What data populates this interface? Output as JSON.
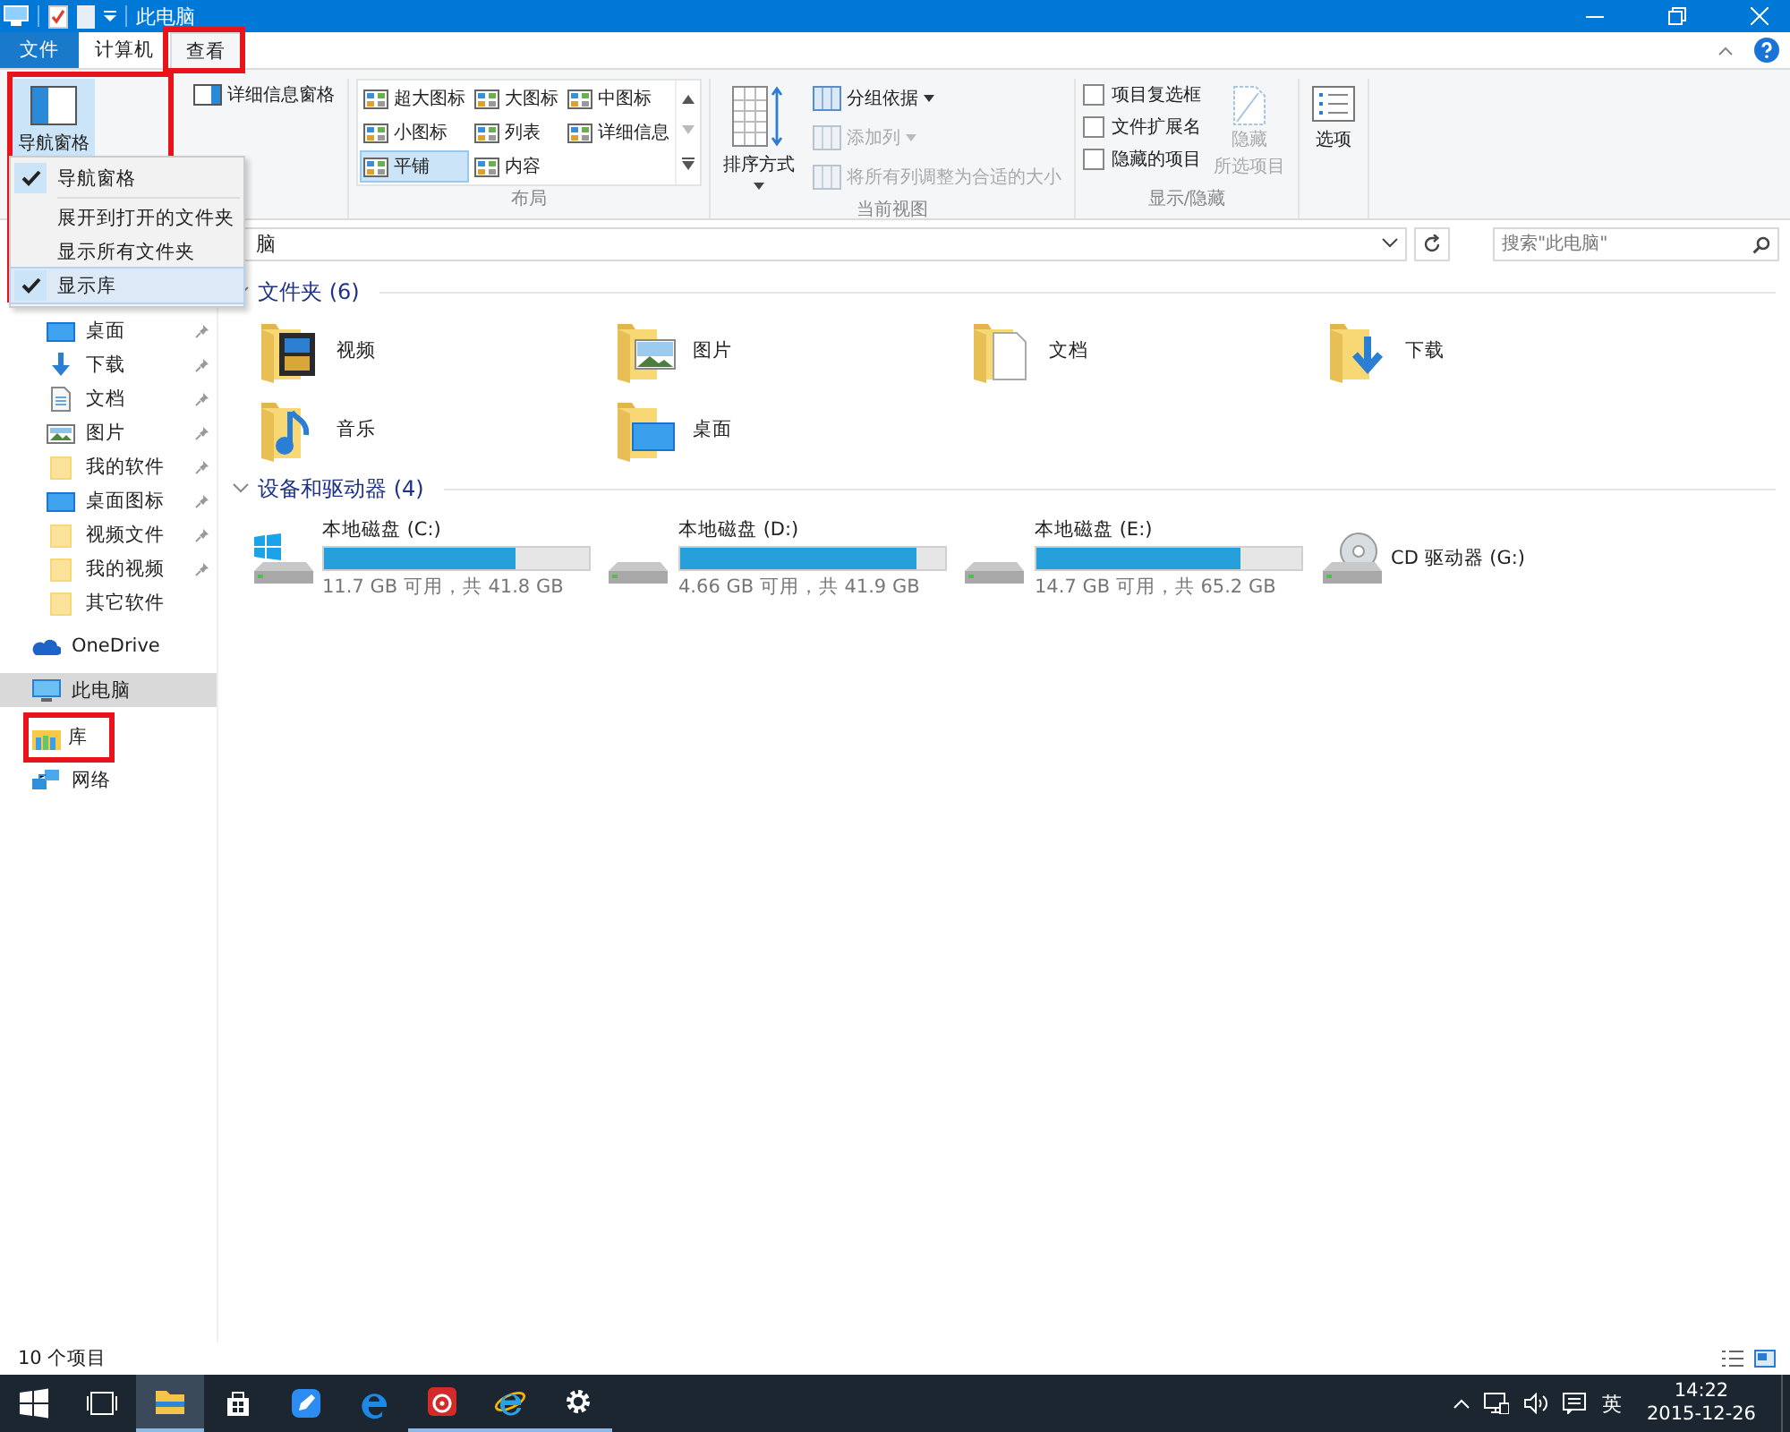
{
  "window": {
    "title": "此电脑"
  },
  "ribbon_tabs": [
    {
      "label": "文件",
      "kind": "file",
      "selected": false
    },
    {
      "label": "计算机",
      "kind": "tab",
      "selected": false
    },
    {
      "label": "查看",
      "kind": "tab",
      "selected": true
    }
  ],
  "ribbon": {
    "panes": {
      "navigation_pane": {
        "label": "导航窗格",
        "selected": true
      },
      "details_pane": {
        "label": "详细信息窗格"
      }
    },
    "layout": {
      "label": "布局",
      "options": [
        {
          "label": "超大图标",
          "selected": false
        },
        {
          "label": "大图标",
          "selected": false
        },
        {
          "label": "中图标",
          "selected": false
        },
        {
          "label": "小图标",
          "selected": false
        },
        {
          "label": "列表",
          "selected": false
        },
        {
          "label": "详细信息",
          "selected": false
        },
        {
          "label": "平铺",
          "selected": true
        },
        {
          "label": "内容",
          "selected": false
        }
      ]
    },
    "current_view": {
      "label": "当前视图",
      "sort": "排序方式",
      "commands": [
        {
          "label": "分组依据",
          "disabled": false,
          "dropdown": true
        },
        {
          "label": "添加列",
          "disabled": true,
          "dropdown": true
        },
        {
          "label": "将所有列调整为合适的大小",
          "disabled": true,
          "dropdown": false
        }
      ]
    },
    "show_hide": {
      "label": "显示/隐藏",
      "checkboxes": [
        {
          "label": "项目复选框",
          "checked": false
        },
        {
          "label": "文件扩展名",
          "checked": false
        },
        {
          "label": "隐藏的项目",
          "checked": false
        }
      ],
      "hide_selected": {
        "lines": [
          "隐藏",
          "所选项目"
        ],
        "disabled": true
      }
    },
    "options": "选项"
  },
  "nav_menu": [
    {
      "label": "导航窗格",
      "checked": true,
      "selected": false
    },
    {
      "label": "展开到打开的文件夹",
      "checked": false,
      "selected": false
    },
    {
      "label": "显示所有文件夹",
      "checked": false,
      "selected": false
    },
    {
      "label": "显示库",
      "checked": true,
      "selected": true
    }
  ],
  "address": {
    "text": "脑"
  },
  "search": {
    "placeholder": "搜索\"此电脑\""
  },
  "nav_pane": [
    {
      "label": "桌面",
      "kind": "desktop",
      "pinned": true,
      "selected": false
    },
    {
      "label": "下载",
      "kind": "download",
      "pinned": true,
      "selected": false
    },
    {
      "label": "文档",
      "kind": "document",
      "pinned": true,
      "selected": false
    },
    {
      "label": "图片",
      "kind": "pictures",
      "pinned": true,
      "selected": false
    },
    {
      "label": "我的软件",
      "kind": "folder",
      "pinned": true,
      "selected": false
    },
    {
      "label": "桌面图标",
      "kind": "desktop",
      "pinned": true,
      "selected": false
    },
    {
      "label": "视频文件",
      "kind": "folder",
      "pinned": true,
      "selected": false
    },
    {
      "label": "我的视频",
      "kind": "folder",
      "pinned": true,
      "selected": false
    },
    {
      "label": "其它软件",
      "kind": "folder",
      "pinned": false,
      "selected": false
    },
    {
      "label": "OneDrive",
      "kind": "onedrive",
      "pinned": false,
      "selected": false
    },
    {
      "label": "此电脑",
      "kind": "computer",
      "pinned": false,
      "selected": true
    },
    {
      "label": "库",
      "kind": "library",
      "pinned": false,
      "selected": false
    },
    {
      "label": "网络",
      "kind": "network",
      "pinned": false,
      "selected": false
    }
  ],
  "folders": {
    "title": "文件夹 (6)",
    "expanded": true,
    "items": [
      {
        "name": "视频",
        "kind": "video"
      },
      {
        "name": "图片",
        "kind": "pictures"
      },
      {
        "name": "文档",
        "kind": "document"
      },
      {
        "name": "下载",
        "kind": "download"
      },
      {
        "name": "音乐",
        "kind": "music"
      },
      {
        "name": "桌面",
        "kind": "desktop"
      }
    ]
  },
  "devices": {
    "title": "设备和驱动器 (4)",
    "expanded": true,
    "items": [
      {
        "name": "本地磁盘 (C:)",
        "kind": "system",
        "level": 0.72,
        "free": "11.7 GB 可用，共 41.8 GB"
      },
      {
        "name": "本地磁盘 (D:)",
        "kind": "disk",
        "level": 0.89,
        "free": "4.66 GB 可用，共 41.9 GB"
      },
      {
        "name": "本地磁盘 (E:)",
        "kind": "disk",
        "level": 0.77,
        "free": "14.7 GB 可用，共 65.2 GB"
      },
      {
        "name": "CD 驱动器 (G:)",
        "kind": "cd"
      }
    ]
  },
  "status_bar": {
    "count": "10 个项目"
  },
  "taskbar": {
    "apps": [
      {
        "kind": "start",
        "running": false,
        "selected": false
      },
      {
        "kind": "taskview",
        "running": false,
        "selected": false
      },
      {
        "kind": "explorer",
        "running": true,
        "selected": true
      },
      {
        "kind": "store",
        "running": false,
        "selected": false
      },
      {
        "kind": "pen",
        "running": false,
        "selected": false
      },
      {
        "kind": "edge",
        "running": false,
        "selected": false
      },
      {
        "kind": "music",
        "running": true,
        "selected": false
      },
      {
        "kind": "ie",
        "running": true,
        "selected": false
      },
      {
        "kind": "settings",
        "running": true,
        "selected": false
      }
    ],
    "ime": "英",
    "time": "14:22",
    "date": "2015-12-26"
  }
}
